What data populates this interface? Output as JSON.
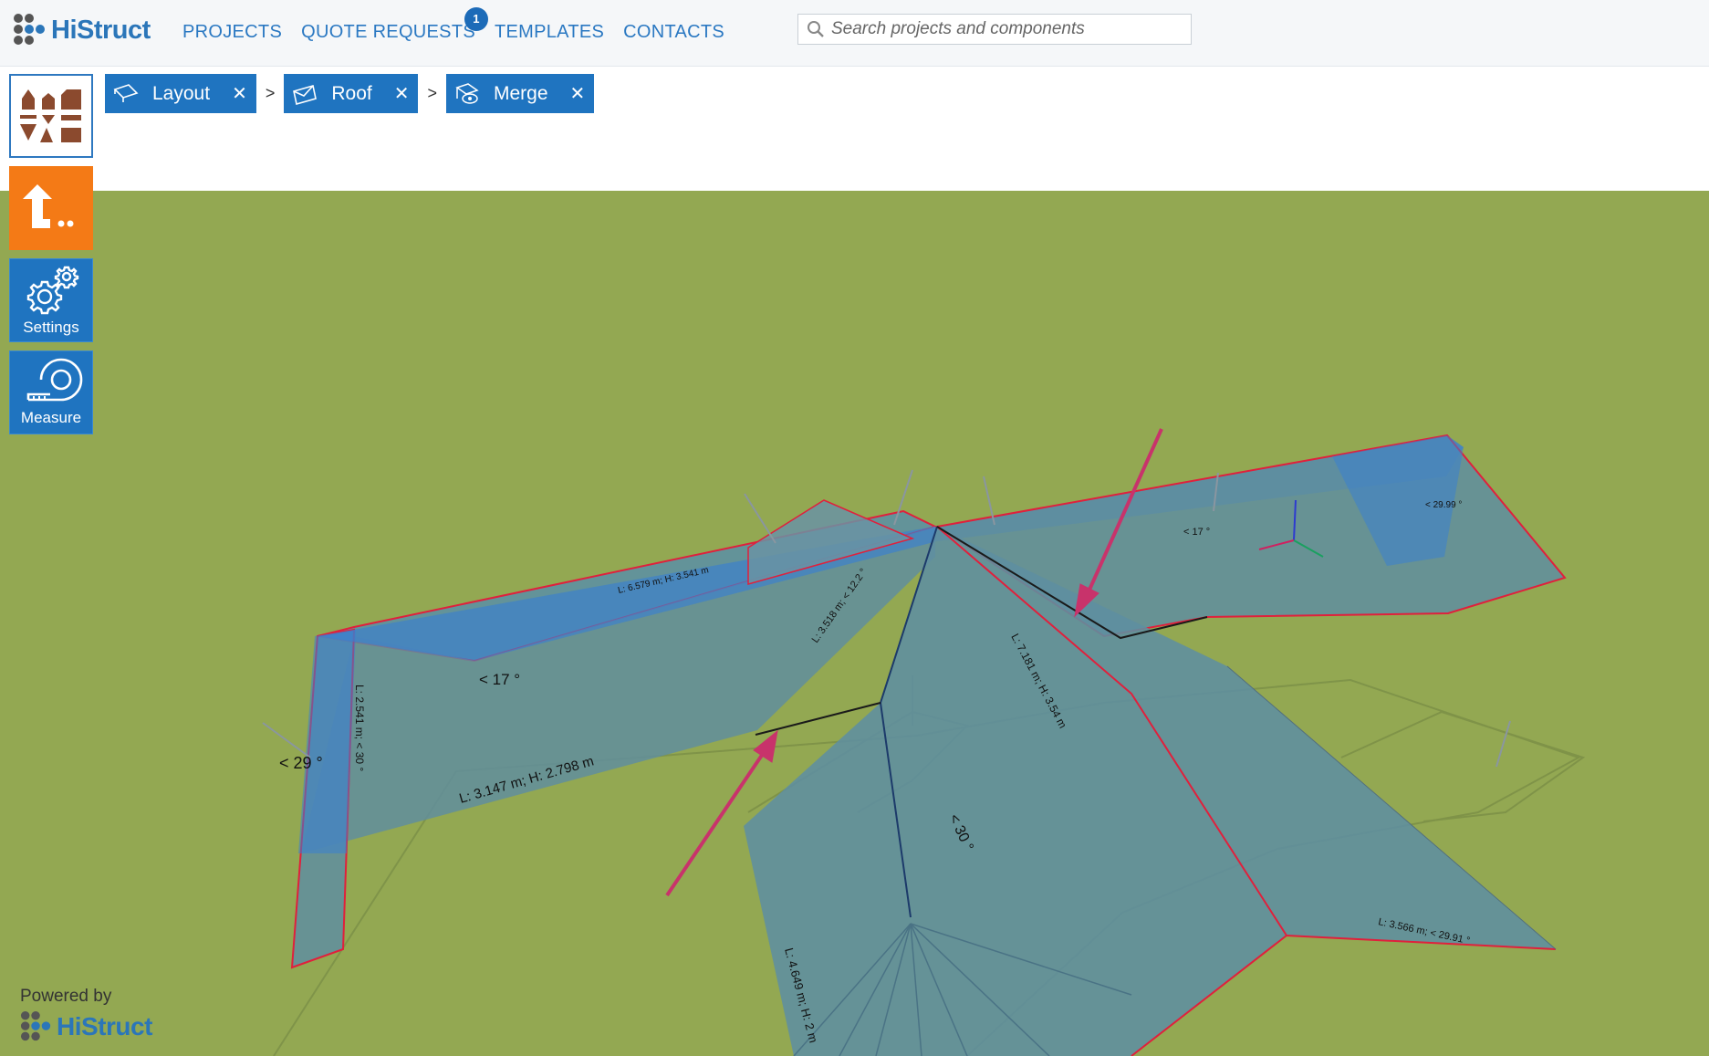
{
  "app": {
    "logo_text": "HiStruct"
  },
  "nav": {
    "items": [
      {
        "label": "PROJECTS"
      },
      {
        "label": "QUOTE REQUESTS",
        "badge": "1"
      },
      {
        "label": "TEMPLATES"
      },
      {
        "label": "CONTACTS"
      }
    ]
  },
  "search": {
    "placeholder": "Search projects and components",
    "value": ""
  },
  "breadcrumb": {
    "items": [
      {
        "label": "Layout",
        "icon": "layout-icon"
      },
      {
        "label": "Roof",
        "icon": "roof-icon"
      },
      {
        "label": "Merge",
        "icon": "merge-icon"
      }
    ],
    "separator": ">",
    "close_glyph": "✕"
  },
  "tools": {
    "components": {
      "icon": "components-icon"
    },
    "upload": {
      "icon": "upload-arrow-icon"
    },
    "settings": {
      "label": "Settings",
      "icon": "gear-icon"
    },
    "measure": {
      "label": "Measure",
      "icon": "tape-measure-icon"
    }
  },
  "viewport": {
    "ground_color": "#93a852",
    "roof_color": "#5b8fa6",
    "edge_color": "#e0203c",
    "arrow_color": "#c8336b",
    "labels": {
      "l1": "L: 3.147 m; H: 2.798 m",
      "l2": "< 17 °",
      "l3": "< 29 °",
      "l4": "< 30 °",
      "l5": "L: 4.649 m; H: 2 m",
      "l6": "L: 3.518 m; < 12.2 °",
      "l7": "< 17 °",
      "l8": "L: 6.579 m; H: 3.541 m",
      "l9": "L: 7.181 m; H: 3.54 m",
      "l10": "L: 3.566 m; < 29.91 °",
      "l11": "< 29.99 °",
      "l12": "L: 2.541 m; < 30 °"
    }
  },
  "footer": {
    "powered_by": "Powered by",
    "logo_text": "HiStruct"
  }
}
